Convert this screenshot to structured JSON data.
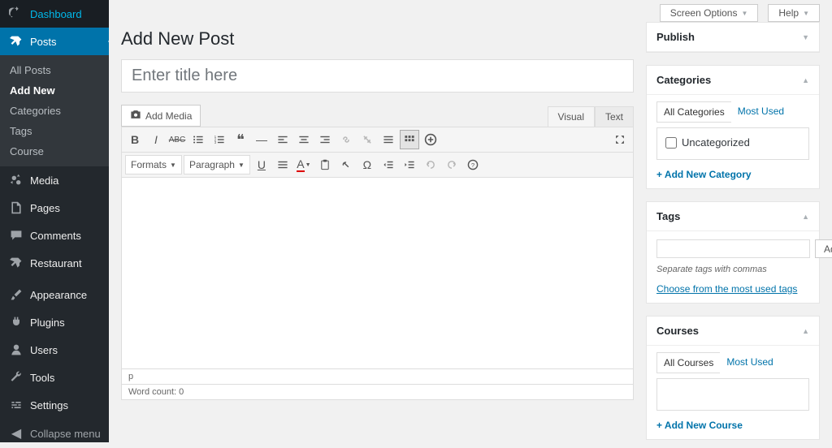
{
  "topbar": {
    "screen_options": "Screen Options",
    "help": "Help"
  },
  "sidebar": {
    "dashboard": "Dashboard",
    "posts": "Posts",
    "media": "Media",
    "pages": "Pages",
    "comments": "Comments",
    "restaurant": "Restaurant",
    "appearance": "Appearance",
    "plugins": "Plugins",
    "users": "Users",
    "tools": "Tools",
    "settings": "Settings",
    "collapse": "Collapse menu",
    "submenu": {
      "all_posts": "All Posts",
      "add_new": "Add New",
      "categories": "Categories",
      "tags": "Tags",
      "course": "Course"
    }
  },
  "page": {
    "title": "Add New Post"
  },
  "title_field": {
    "placeholder": "Enter title here",
    "value": ""
  },
  "media": {
    "add": "Add Media"
  },
  "editor_tabs": {
    "visual": "Visual",
    "text": "Text"
  },
  "toolbar": {
    "formats": "Formats",
    "paragraph": "Paragraph"
  },
  "status": {
    "path": "p",
    "word_count": "Word count: 0"
  },
  "publish": {
    "title": "Publish"
  },
  "categories": {
    "title": "Categories",
    "tab_all": "All Categories",
    "tab_most": "Most Used",
    "uncategorized": "Uncategorized",
    "add": "+ Add New Category"
  },
  "tags": {
    "title": "Tags",
    "add": "Add",
    "hint": "Separate tags with commas",
    "choose": "Choose from the most used tags"
  },
  "courses": {
    "title": "Courses",
    "tab_all": "All Courses",
    "tab_most": "Most Used",
    "add": "+ Add New Course"
  }
}
